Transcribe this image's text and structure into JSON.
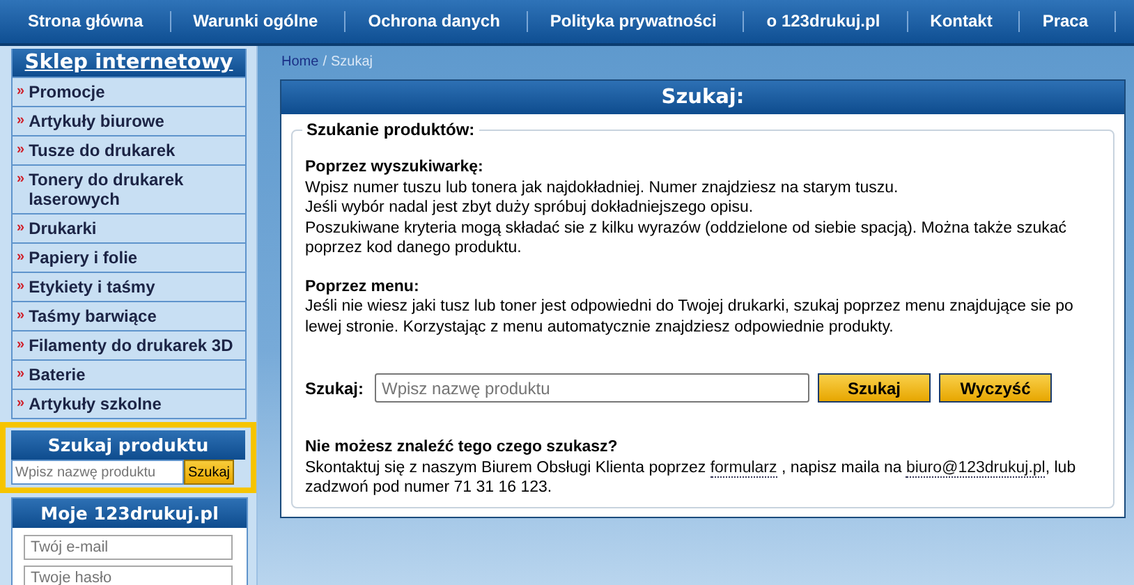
{
  "nav": [
    "Strona główna",
    "Warunki ogólne",
    "Ochrona danych",
    "Polityka prywatności",
    "o 123drukuj.pl",
    "Kontakt",
    "Praca"
  ],
  "sidebar": {
    "title": "Sklep internetowy",
    "items": [
      {
        "label": "Promocje"
      },
      {
        "label": "Artykuły biurowe"
      },
      {
        "label": "Tusze do drukarek"
      },
      {
        "label": "Tonery do drukarek laserowych"
      },
      {
        "label": "Drukarki"
      },
      {
        "label": "Papiery i folie"
      },
      {
        "label": "Etykiety i taśmy"
      },
      {
        "label": "Taśmy barwiące"
      },
      {
        "label": "Filamenty do drukarek 3D"
      },
      {
        "label": "Baterie"
      },
      {
        "label": "Artykuły szkolne"
      }
    ],
    "bullet": "»"
  },
  "quick_search": {
    "title": "Szukaj produktu",
    "placeholder": "Wpisz nazwę produktu",
    "button": "Szukaj"
  },
  "account": {
    "title": "Moje 123drukuj.pl",
    "fields": [
      {
        "placeholder": "Twój e-mail"
      },
      {
        "placeholder": "Twoje hasło"
      }
    ]
  },
  "breadcrumb": {
    "home": "Home",
    "separator": "/",
    "current": "Szukaj"
  },
  "panel": {
    "title": "Szukaj:",
    "legend": "Szukanie produktów:",
    "sections": [
      {
        "heading": "Poprzez wyszukiwarkę:",
        "lines": [
          "Wpisz numer tuszu lub tonera jak najdokładniej. Numer znajdziesz na starym tuszu.",
          "Jeśli wybór nadal jest zbyt duży spróbuj dokładniejszego opisu.",
          "Poszukiwane kryteria mogą składać sie z kilku wyrazów (oddzielone od siebie spacją). Można także szukać poprzez kod danego produktu."
        ]
      },
      {
        "heading": "Poprzez menu:",
        "lines": [
          "Jeśli nie wiesz jaki tusz lub toner jest odpowiedni do Twojej drukarki, szukaj poprzez menu znajdujące sie po lewej stronie. Korzystając z menu automatycznie znajdziesz odpowiednie produkty."
        ]
      }
    ],
    "search": {
      "label": "Szukaj:",
      "placeholder": "Wpisz nazwę produktu",
      "buttons": [
        "Szukaj",
        "Wyczyść"
      ]
    },
    "contact": {
      "heading": "Nie możesz znaleźć tego czego szukasz?",
      "parts": [
        {
          "kind": "text",
          "text": "Skontaktuj się z naszym Biurem Obsługi Klienta poprzez "
        },
        {
          "kind": "link",
          "text": "formularz"
        },
        {
          "kind": "text",
          "text": " , napisz maila na "
        },
        {
          "kind": "link",
          "text": "biuro@123drukuj.pl"
        },
        {
          "kind": "text",
          "text": ", lub zadzwoń pod numer 71 31 16 123."
        }
      ]
    }
  }
}
